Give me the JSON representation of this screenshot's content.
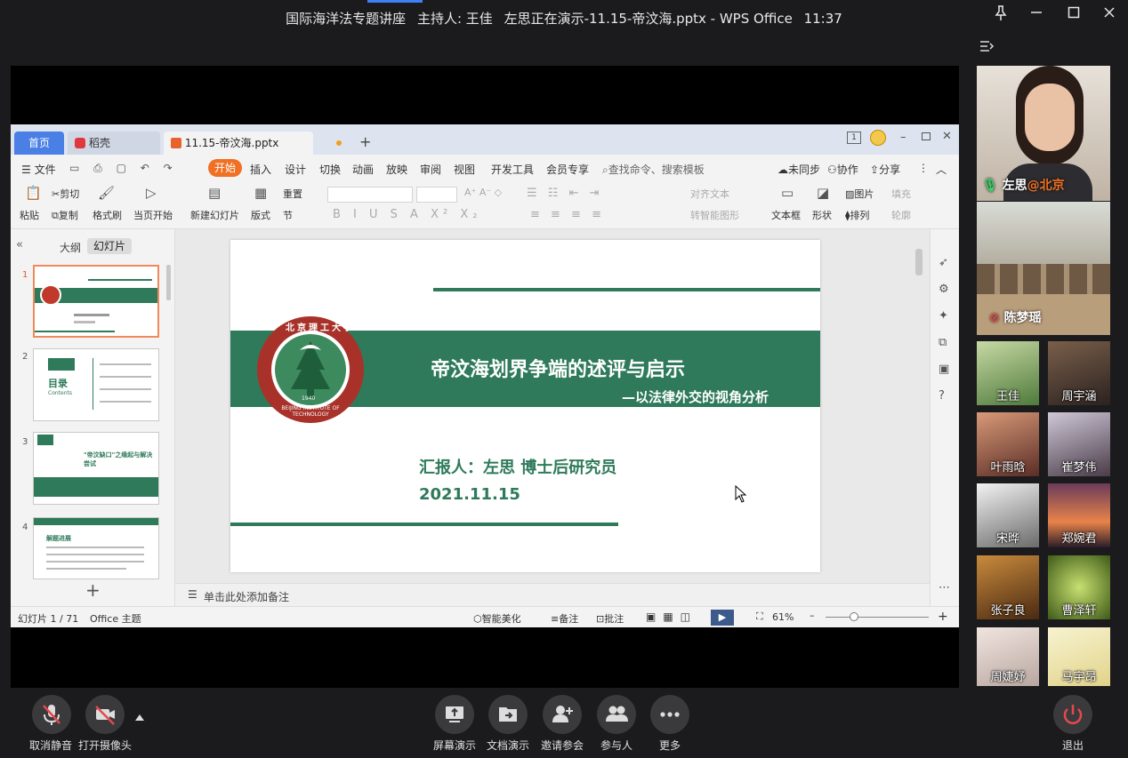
{
  "window": {
    "meeting_name": "国际海洋法专题讲座",
    "host": "主持人: 王佳",
    "presenting": "左思正在演示-11.15-帝汶海.pptx - WPS Office",
    "time": "11:37",
    "controls": {
      "pin": "⚲",
      "minimize": "—",
      "maximize": "☐",
      "close": "✕"
    }
  },
  "wps": {
    "tabs": {
      "home": "首页",
      "daoke": "稻壳",
      "file": "11.15-帝汶海.pptx"
    },
    "menu": {
      "file": "文件",
      "start": "开始",
      "items": [
        "插入",
        "设计",
        "切换",
        "动画",
        "放映",
        "审阅",
        "视图",
        "开发工具",
        "会员专享"
      ],
      "search": "查找命令、搜索模板",
      "unsynced": "未同步",
      "collab": "协作",
      "share": "分享"
    },
    "ribbon": {
      "paste": "粘贴",
      "cut": "剪切",
      "copy": "复制",
      "format_painter": "格式刷",
      "from_current": "当页开始",
      "new_slide": "新建幻灯片",
      "layout": "版式",
      "reset": "重置",
      "section": "节",
      "align_text": "对齐文本",
      "smart_shape": "转智能图形",
      "textbox": "文本框",
      "shape": "形状",
      "picture": "图片",
      "arrange": "排列",
      "fill": "填充",
      "outline": "轮廓"
    },
    "left_pane": {
      "outline_tab": "大纲",
      "slides_tab": "幻灯片",
      "thumbs": [
        {
          "num": "1"
        },
        {
          "num": "2",
          "title": "目录",
          "sub": "Contents"
        },
        {
          "num": "3",
          "title": "\"帝汶缺口\"之缘起与解决尝试"
        },
        {
          "num": "4",
          "title": "解题进展"
        }
      ]
    },
    "slide": {
      "university_top": "北京理工大学",
      "university_en": "BEIJING INSTITUTE OF TECHNOLOGY",
      "year": "1940",
      "title": "帝汶海划界争端的述评与启示",
      "subtitle": "—以法律外交的视角分析",
      "reporter": "汇报人：左思 博士后研究员",
      "date": "2021.11.15",
      "accent_color": "#2e7a5a"
    },
    "notes_placeholder": "单击此处添加备注",
    "status": {
      "slide_count": "幻灯片 1 / 71",
      "theme": "Office 主题",
      "beautify": "智能美化",
      "notes": "备注",
      "comments": "批注",
      "zoom": "61%"
    }
  },
  "participants": {
    "speaker": {
      "name": "左思",
      "location": "@北京"
    },
    "second": {
      "name": "陈梦瑶"
    },
    "grid": [
      {
        "name": "王佳"
      },
      {
        "name": "周宇涵"
      },
      {
        "name": "叶雨晗"
      },
      {
        "name": "崔梦伟"
      },
      {
        "name": "宋晔"
      },
      {
        "name": "郑婉君"
      },
      {
        "name": "张子良"
      },
      {
        "name": "曹泽轩"
      },
      {
        "name": "周婕妤"
      },
      {
        "name": "马宇昂"
      }
    ]
  },
  "toolbar": {
    "unmute": "取消静音",
    "camera": "打开摄像头",
    "screen_share": "屏幕演示",
    "doc_share": "文档演示",
    "invite": "邀请参会",
    "participants": "参与人",
    "more": "更多",
    "leave": "退出"
  },
  "colors": {
    "accent": "#f07024",
    "wps_blue": "#4a7fe5",
    "leave_red": "#e5484d",
    "slide_green": "#2e7a5a"
  }
}
